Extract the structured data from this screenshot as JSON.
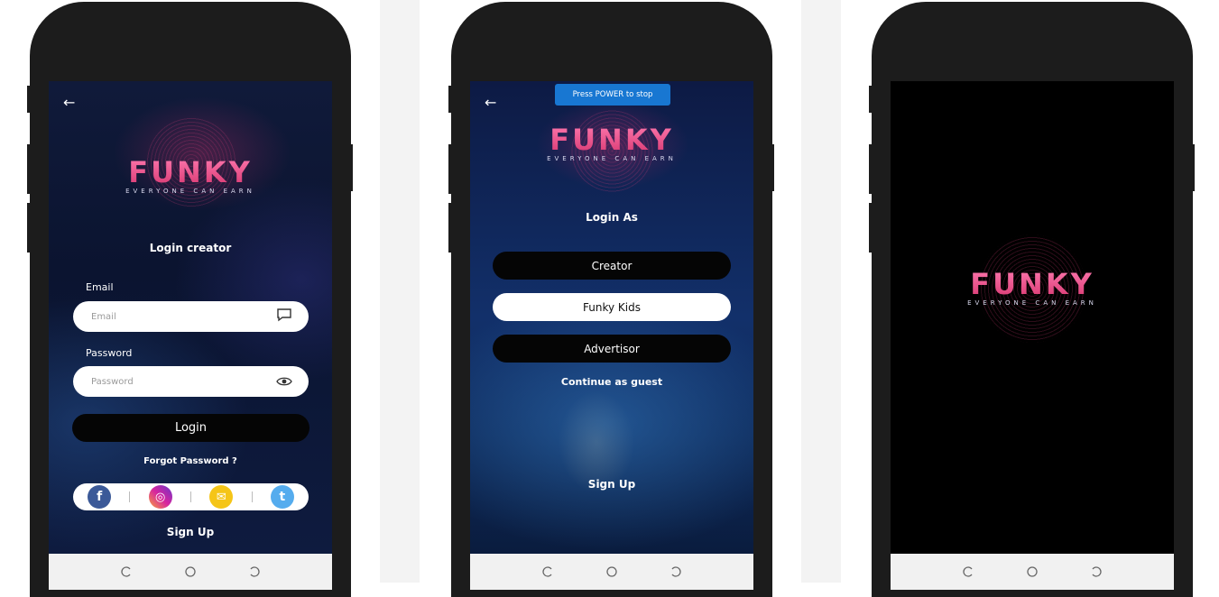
{
  "screens": {
    "login_creator": {
      "back_icon": "arrow-left-icon",
      "logo": {
        "word": "FUNKY",
        "tagline": "EVERYONE CAN EARN"
      },
      "title": "Login creator",
      "email": {
        "label": "Email",
        "placeholder": "Email",
        "icon": "message-icon"
      },
      "password": {
        "label": "Password",
        "placeholder": "Password",
        "icon": "eye-icon"
      },
      "login_button": "Login",
      "forgot": "Forgot Password ?",
      "social": [
        {
          "name": "facebook-icon",
          "glyph": "f",
          "color": "#3b5998"
        },
        {
          "name": "instagram-icon",
          "glyph": "◎",
          "color": "#d6249f"
        },
        {
          "name": "mail-icon",
          "glyph": "✉",
          "color": "#f5c518"
        },
        {
          "name": "twitter-icon",
          "glyph": "t",
          "color": "#55acee"
        }
      ],
      "sign_up": "Sign Up"
    },
    "login_as": {
      "toast": "Press POWER to stop",
      "logo": {
        "word": "FUNKY",
        "tagline": "EVERYONE CAN EARN"
      },
      "title": "Login As",
      "options": [
        "Creator",
        "Funky Kids",
        "Advertisor"
      ],
      "guest": "Continue as guest",
      "sign_up": "Sign Up"
    },
    "splash": {
      "logo": {
        "word": "FUNKY",
        "tagline": "EVERYONE CAN EARN"
      }
    }
  },
  "colors": {
    "accent": "#e8467f",
    "toast": "#1877d2"
  }
}
